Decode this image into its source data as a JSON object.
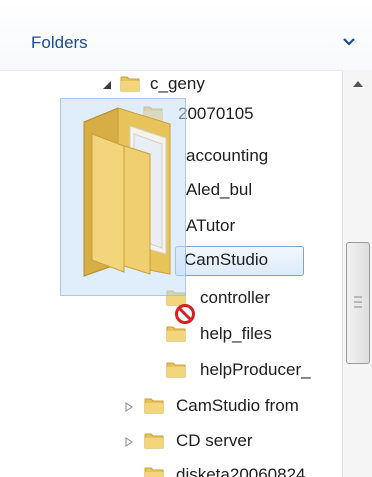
{
  "header": {
    "title": "Folders"
  },
  "tree": {
    "rows": [
      {
        "label": "c_geny",
        "expander": "expanded"
      },
      {
        "label": "20070105",
        "expander": "none"
      },
      {
        "label": "accounting",
        "expander": "collapsed"
      },
      {
        "label": "Aled_bul",
        "expander": "collapsed"
      },
      {
        "label": "ATutor",
        "expander": "collapsed"
      },
      {
        "label": "CamStudio",
        "expander": "none",
        "selected": true
      },
      {
        "label": "controller",
        "expander": "none"
      },
      {
        "label": "help_files",
        "expander": "none"
      },
      {
        "label": "helpProducer_",
        "expander": "none"
      },
      {
        "label": "CamStudio from",
        "expander": "collapsed"
      },
      {
        "label": "CD server",
        "expander": "collapsed"
      },
      {
        "label": "disketa20060824",
        "expander": "none"
      }
    ]
  },
  "drag": {
    "cursor": "no-drop-icon"
  },
  "colors": {
    "header_text": "#1d4d8c",
    "folder_yellow": "#e8c35a",
    "selection_border": "#7da2ce",
    "no_drop_red": "#d9201f"
  }
}
